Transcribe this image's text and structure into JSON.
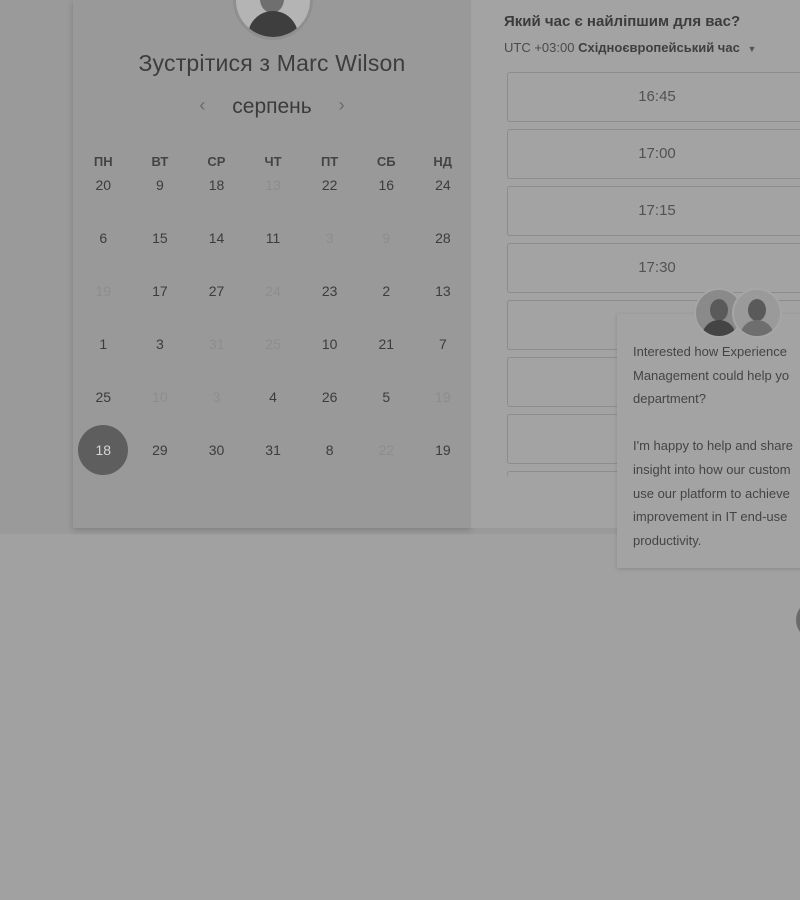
{
  "scheduler": {
    "title": "Зустрітися з Marc Wilson",
    "month": "серпень",
    "prev_month_icon": "chevron-left-icon",
    "next_month_icon": "chevron-right-icon",
    "weekdays": [
      "ПН",
      "ВТ",
      "СР",
      "ЧТ",
      "ПТ",
      "СБ",
      "НД"
    ],
    "days": [
      {
        "label": "20",
        "muted": false
      },
      {
        "label": "9",
        "muted": false
      },
      {
        "label": "18",
        "muted": false
      },
      {
        "label": "13",
        "muted": true
      },
      {
        "label": "22",
        "muted": false
      },
      {
        "label": "16",
        "muted": false
      },
      {
        "label": "24",
        "muted": false
      },
      {
        "label": "6",
        "muted": false
      },
      {
        "label": "15",
        "muted": false
      },
      {
        "label": "14",
        "muted": false
      },
      {
        "label": "11",
        "muted": false
      },
      {
        "label": "3",
        "muted": true
      },
      {
        "label": "9",
        "muted": true
      },
      {
        "label": "28",
        "muted": false
      },
      {
        "label": "19",
        "muted": true
      },
      {
        "label": "17",
        "muted": false
      },
      {
        "label": "27",
        "muted": false
      },
      {
        "label": "24",
        "muted": true
      },
      {
        "label": "23",
        "muted": false
      },
      {
        "label": "2",
        "muted": false
      },
      {
        "label": "13",
        "muted": false
      },
      {
        "label": "1",
        "muted": false
      },
      {
        "label": "3",
        "muted": false
      },
      {
        "label": "31",
        "muted": true
      },
      {
        "label": "25",
        "muted": true
      },
      {
        "label": "10",
        "muted": false
      },
      {
        "label": "21",
        "muted": false
      },
      {
        "label": "7",
        "muted": false
      },
      {
        "label": "25",
        "muted": false
      },
      {
        "label": "10",
        "muted": true
      },
      {
        "label": "3",
        "muted": true
      },
      {
        "label": "4",
        "muted": false
      },
      {
        "label": "26",
        "muted": false
      },
      {
        "label": "5",
        "muted": false
      },
      {
        "label": "19",
        "muted": true
      },
      {
        "label": "18",
        "muted": false,
        "selected": true
      },
      {
        "label": "29",
        "muted": false
      },
      {
        "label": "30",
        "muted": false
      },
      {
        "label": "31",
        "muted": false
      },
      {
        "label": "8",
        "muted": false
      },
      {
        "label": "22",
        "muted": true
      },
      {
        "label": "19",
        "muted": false
      }
    ]
  },
  "time_panel": {
    "question": "Який час є найліпшим для вас?",
    "tz_offset": "UTC +03:00",
    "tz_name": "Східноєвропейський час",
    "tz_caret_icon": "caret-down-icon",
    "slots": [
      "16:45",
      "17:00",
      "17:15",
      "17:30",
      "",
      "",
      "",
      ""
    ]
  },
  "chat": {
    "message": "Interested how Experience\nManagement could help yo\ndepartment?\n\nI'm happy to help and share\ninsight into how our custom\nuse our platform to achieve\nimprovement in IT end-use\nproductivity."
  },
  "colors": {
    "overlay": "#a1a1a1",
    "selected_day": "#5e5e5e"
  }
}
